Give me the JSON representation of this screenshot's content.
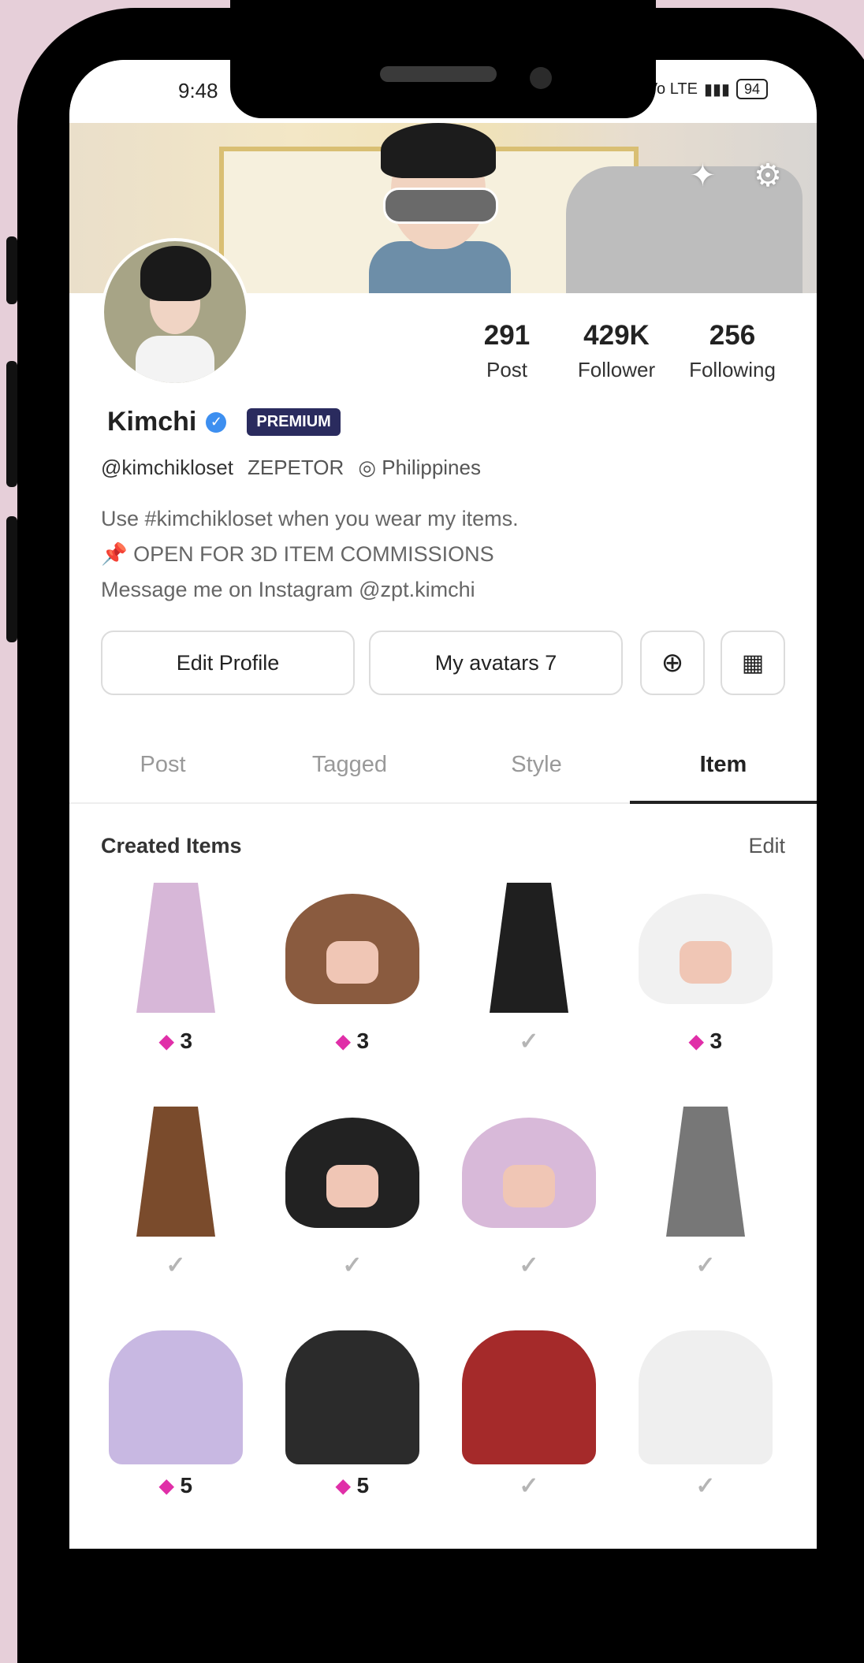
{
  "status_bar": {
    "time": "9:48",
    "signal": "Vo LTE",
    "battery": "94"
  },
  "profile": {
    "name": "Kimchi",
    "badge": "PREMIUM",
    "handle": "@kimchikloset",
    "role": "ZEPETOR",
    "location": "Philippines",
    "bio": [
      "Use #kimchikloset when you wear my items.",
      "📌 OPEN FOR 3D ITEM COMMISSIONS",
      "Message me on Instagram @zpt.kimchi"
    ],
    "stats": [
      {
        "value": "291",
        "label": "Post"
      },
      {
        "value": "429K",
        "label": "Follower"
      },
      {
        "value": "256",
        "label": "Following"
      }
    ]
  },
  "actions": {
    "edit_profile": "Edit Profile",
    "my_avatars": "My avatars 7"
  },
  "tabs": [
    "Post",
    "Tagged",
    "Style",
    "Item"
  ],
  "active_tab": "Item",
  "created_items": {
    "title": "Created Items",
    "edit": "Edit",
    "items": [
      {
        "kind": "skirt",
        "color": "#d7b7d8",
        "price": "3"
      },
      {
        "kind": "jacket",
        "color": "#8a5b3f",
        "price": "3"
      },
      {
        "kind": "skirt",
        "color": "#1f1f1f",
        "price": ""
      },
      {
        "kind": "jacket",
        "color": "#f1f1f1",
        "price": "3"
      },
      {
        "kind": "skirt",
        "color": "#7a4b2c",
        "price": ""
      },
      {
        "kind": "jacket",
        "color": "#222222",
        "price": ""
      },
      {
        "kind": "jacket",
        "color": "#d8b9d9",
        "price": ""
      },
      {
        "kind": "skirt",
        "color": "#777777",
        "price": ""
      },
      {
        "kind": "outfit",
        "color": "#c8b8e2",
        "price": "5"
      },
      {
        "kind": "outfit",
        "color": "#2b2b2b",
        "price": "5"
      },
      {
        "kind": "outfit",
        "color": "#a52a2a",
        "price": ""
      },
      {
        "kind": "outfit",
        "color": "#efefef",
        "price": ""
      }
    ]
  }
}
